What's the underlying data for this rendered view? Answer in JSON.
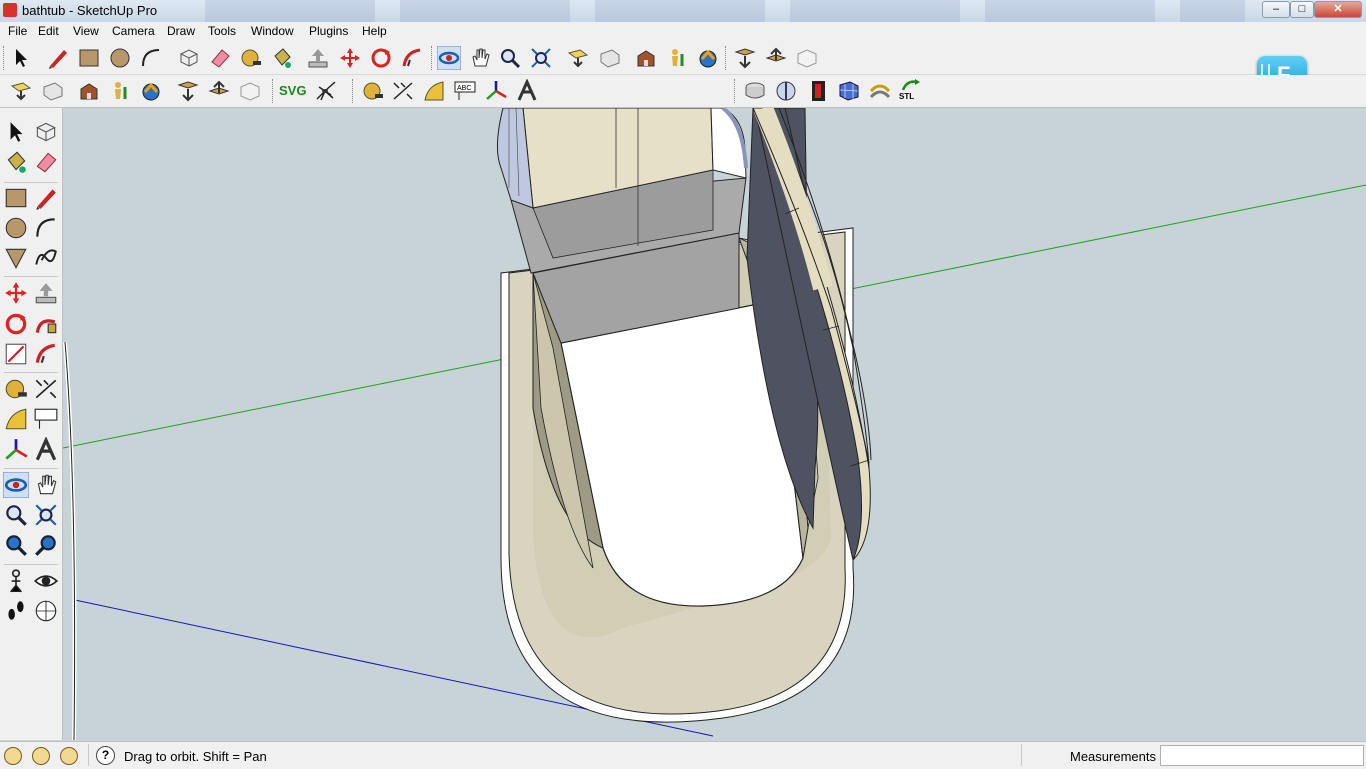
{
  "window": {
    "title": "bathtub - SketchUp Pro",
    "minimize": "–",
    "maximize": "□",
    "close": "✕"
  },
  "menu": [
    "File",
    "Edit",
    "View",
    "Camera",
    "Draw",
    "Tools",
    "Window",
    "Plugins",
    "Help"
  ],
  "toolbar": {
    "svg_label": "SVG",
    "stl_label": "STL",
    "text_tool_label": "ABC"
  },
  "floating_badge": {
    "label": "F"
  },
  "status": {
    "hint": "Drag to orbit.  Shift = Pan",
    "help": "?",
    "measurements_label": "Measurements",
    "measurements_value": ""
  },
  "colors": {
    "viewport_bg": "#c7d3d7",
    "green_axis": "#1fa01f",
    "blue_axis": "#1515c0",
    "tub_outer": "#d9d4c0",
    "tub_inner": "#ffffff",
    "dark_panel": "#4f5260"
  }
}
